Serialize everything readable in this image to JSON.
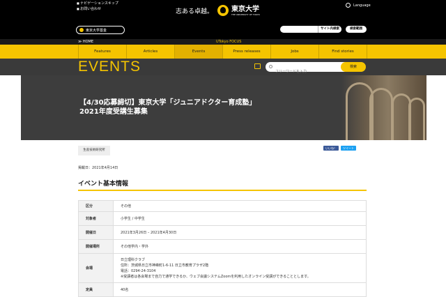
{
  "header": {
    "skip_links": [
      "ナビゲーションスキップ",
      "お問い合わせ"
    ],
    "slogan": "志ある卓越。",
    "university_jp": "東京大学",
    "university_en": "THE UNIVERSITY OF TOKYO",
    "language": "Language",
    "fund_button": "東京大学基金",
    "site_search_button": "サイト内検索",
    "detail_search_button": "検索範囲"
  },
  "breadcrumb": {
    "home": "≫ HOME",
    "section": "UTokyo FOCUS"
  },
  "nav": {
    "tabs": [
      "Features",
      "Articles",
      "Events",
      "Press releases",
      "Jobs",
      "Find stories"
    ],
    "active": "Events"
  },
  "events": {
    "heading": "EVENTS",
    "keyword_placeholder": "フリーワードを入力",
    "search_button": "検索"
  },
  "article": {
    "title": "【4/30応募締切】東京大学「ジュニアドクター育成塾」2021年度受講生募集",
    "tag": "生産技術研究所",
    "share_facebook": "いいね！",
    "share_twitter": "ツイート",
    "posted": "掲載日：2021年4月14日",
    "section_heading": "イベント基本情報",
    "info": [
      {
        "key": "区分",
        "value": [
          "その他"
        ]
      },
      {
        "key": "対象者",
        "value": [
          "小学生 / 中学生"
        ]
      },
      {
        "key": "開催日",
        "value": [
          "2021年3月26日 – 2021年4月30日"
        ]
      },
      {
        "key": "開催場所",
        "value": [
          "その他学内・学外"
        ]
      },
      {
        "key": "会場",
        "value": [
          "日立理科クラブ",
          "住所：茨城県日立市神峰町1-6-11 日立市教育プラザ2階",
          "電話：0294-24-3104",
          "※受講者は各会場まで自力で通学できるか、ウェブ会議システムZoomを利用したオンライン受講ができることとします。"
        ]
      },
      {
        "key": "定員",
        "value": [
          "40名"
        ]
      }
    ]
  }
}
